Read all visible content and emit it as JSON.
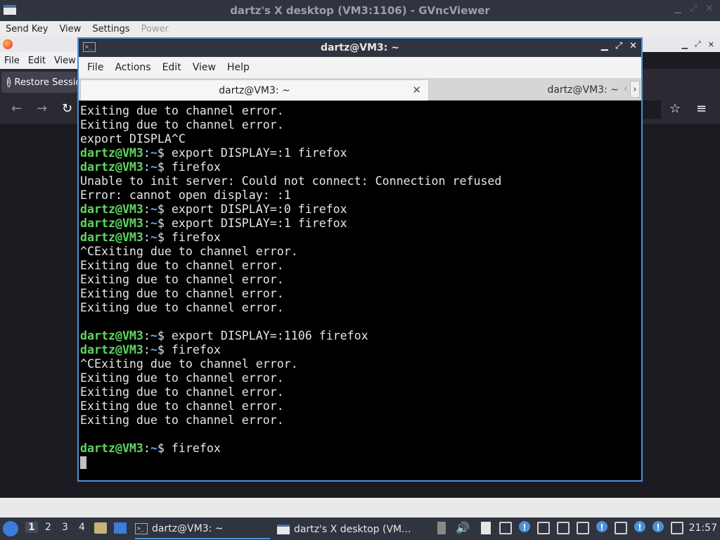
{
  "vnc": {
    "title": "dartz's X desktop (VM3:1106) - GVncViewer",
    "menu": [
      "Send Key",
      "View",
      "Settings",
      "Power"
    ]
  },
  "firefox": {
    "menu": [
      "File",
      "Edit",
      "View"
    ],
    "restore_label": "Restore Session"
  },
  "terminal": {
    "title": "dartz@VM3: ~",
    "menu": [
      "File",
      "Actions",
      "Edit",
      "View",
      "Help"
    ],
    "tabs": [
      "dartz@VM3: ~",
      "dartz@VM3: ~"
    ],
    "prompt_user": "dartz@VM3",
    "prompt_path": "~",
    "lines": [
      {
        "type": "out",
        "text": "Exiting due to channel error."
      },
      {
        "type": "out",
        "text": "Exiting due to channel error."
      },
      {
        "type": "out",
        "text": "export DISPLA^C"
      },
      {
        "type": "cmd",
        "text": "export DISPLAY=:1 firefox"
      },
      {
        "type": "cmd",
        "text": "firefox"
      },
      {
        "type": "out",
        "text": "Unable to init server: Could not connect: Connection refused"
      },
      {
        "type": "out",
        "text": "Error: cannot open display: :1"
      },
      {
        "type": "cmd",
        "text": "export DISPLAY=:0 firefox"
      },
      {
        "type": "cmd",
        "text": "export DISPLAY=:1 firefox"
      },
      {
        "type": "cmd",
        "text": "firefox"
      },
      {
        "type": "out",
        "text": "^CExiting due to channel error."
      },
      {
        "type": "out",
        "text": "Exiting due to channel error."
      },
      {
        "type": "out",
        "text": "Exiting due to channel error."
      },
      {
        "type": "out",
        "text": "Exiting due to channel error."
      },
      {
        "type": "out",
        "text": "Exiting due to channel error."
      },
      {
        "type": "out",
        "text": ""
      },
      {
        "type": "cmd",
        "text": "export DISPLAY=:1106 firefox"
      },
      {
        "type": "cmd",
        "text": "firefox"
      },
      {
        "type": "out",
        "text": "^CExiting due to channel error."
      },
      {
        "type": "out",
        "text": "Exiting due to channel error."
      },
      {
        "type": "out",
        "text": "Exiting due to channel error."
      },
      {
        "type": "out",
        "text": "Exiting due to channel error."
      },
      {
        "type": "out",
        "text": "Exiting due to channel error."
      },
      {
        "type": "out",
        "text": ""
      },
      {
        "type": "cmd",
        "text": "firefox"
      },
      {
        "type": "cursor",
        "text": ""
      }
    ]
  },
  "taskbar": {
    "workspaces": [
      "1",
      "2",
      "3",
      "4"
    ],
    "active_workspace": "1",
    "tasks": [
      {
        "label": "dartz@VM3: ~",
        "icon": "terminal-icon"
      },
      {
        "label": "dartz's X desktop (VM...",
        "icon": "vnc-window-icon"
      }
    ],
    "clock": "21:57"
  },
  "colors": {
    "prompt_user": "#5fd75f",
    "prompt_path": "#5fa8ff",
    "accent": "#4a90d9"
  }
}
